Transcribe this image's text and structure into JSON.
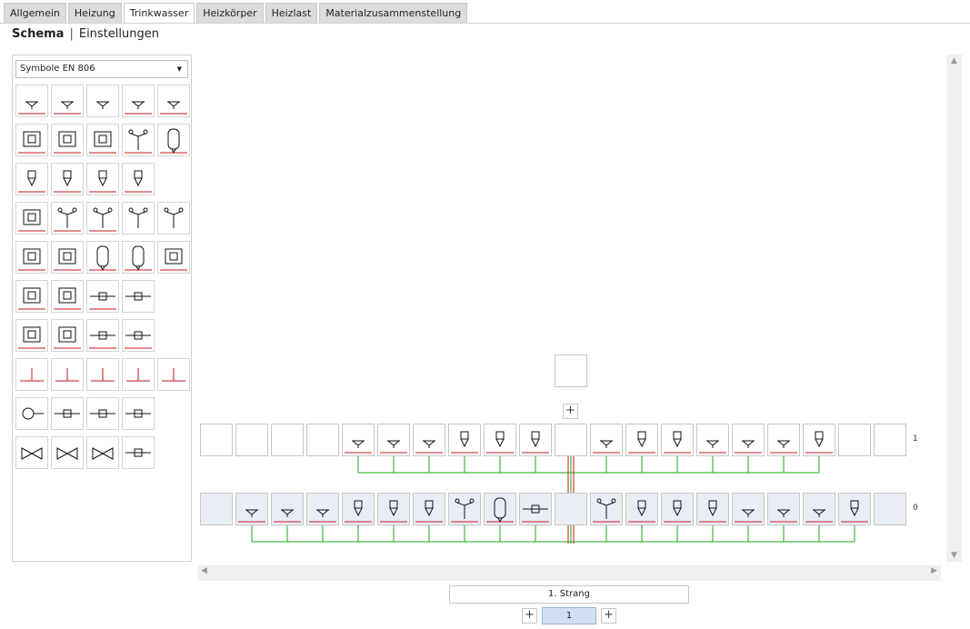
{
  "tabs": [
    "Allgemein",
    "Heizung",
    "Trinkwasser",
    "Heizkörper",
    "Heizlast",
    "Materialzusammenstellung"
  ],
  "active_tab": "Trinkwasser",
  "subnav": {
    "schema": "Schema",
    "separator": "|",
    "settings": "Einstellungen"
  },
  "palette": {
    "symbol_set": "Symbole EN 806",
    "rows": [
      [
        "washbasin-icon",
        "washbasin-small-icon",
        "washbasin-valve-icon",
        "wall-outlet-icon",
        "wall-outlet-long-icon"
      ],
      [
        "sink-icon",
        "kitchen-fitting-icon",
        "kitchen-fitting-2-icon",
        "shower-cabinet-icon",
        "round-tank-icon"
      ],
      [
        "wc-icon",
        "urinal-icon",
        "urinal-2-icon",
        "bidet-icon"
      ],
      [
        "bathtub-icon",
        "shower-tray-icon",
        "shower-head-icon",
        "spring-valve-icon",
        "needle-valve-icon"
      ],
      [
        "boiler-icon",
        "boiler-2-icon",
        "storage-tank-icon",
        "storage-heated-icon",
        "heater-unit-icon"
      ],
      [
        "water-heater-icon",
        "instant-heater-icon",
        "meter-box-icon",
        "small-meter-icon"
      ],
      [
        "distribution-icon",
        "distribution-2-icon",
        "connector-icon",
        "connector-2-icon"
      ],
      [
        "tee-icon",
        "tee-2-icon",
        "bend-icon",
        "tee-down-icon",
        "tee-red-icon"
      ],
      [
        "pump-icon",
        "meter-icon",
        "counter-unit-icon",
        "multi-counter-icon"
      ],
      [
        "gate-valve-icon",
        "valve-icon",
        "valve-group-icon",
        "inline-meter-icon"
      ]
    ]
  },
  "schema": {
    "floors": [
      {
        "label": "1",
        "cells": [
          "empty",
          "empty",
          "empty",
          "empty",
          "washbasin",
          "washbasin",
          "washbasin",
          "wc",
          "wc",
          "wc",
          "riser",
          "washbasin",
          "bidet",
          "bidet",
          "washbasin",
          "washbasin",
          "washbasin",
          "wc",
          "empty",
          "empty"
        ]
      },
      {
        "label": "0",
        "cells": [
          "empty",
          "washbasin",
          "washbasin",
          "washbasin",
          "wc",
          "wc",
          "wc",
          "shower",
          "tank",
          "meter",
          "riser",
          "shower",
          "bidet",
          "bidet",
          "bidet",
          "washbasin",
          "washbasin",
          "washbasin",
          "wc",
          "empty"
        ]
      }
    ],
    "colors": {
      "pipe": "#1aa81a",
      "riser": "#c21818",
      "cell_line": "#c21818"
    }
  },
  "strang_label": "1. Strang",
  "page_number": "1",
  "add_symbol": "+"
}
